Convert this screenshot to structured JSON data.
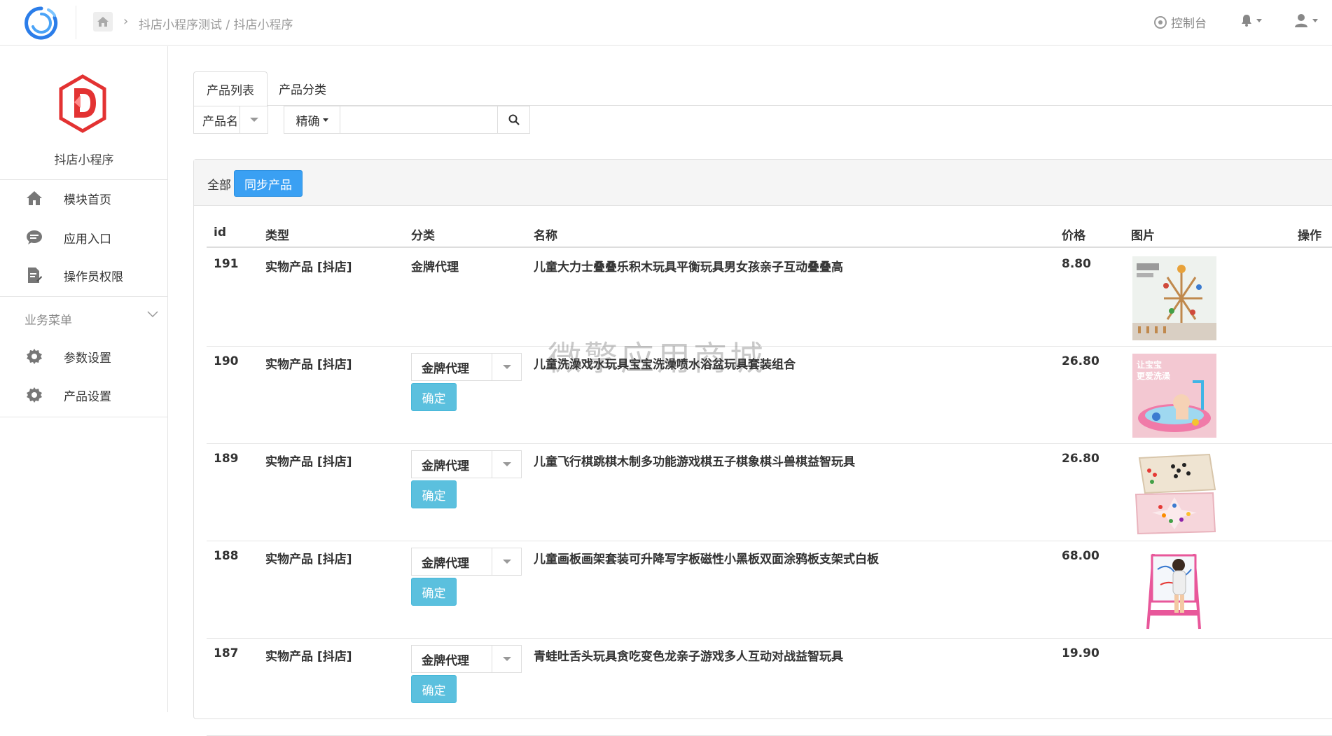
{
  "header": {
    "breadcrumb": "抖店小程序测试 / 抖店小程序",
    "console_label": "控制台"
  },
  "sidebar": {
    "app_name": "抖店小程序",
    "items": [
      {
        "label": "模块首页",
        "icon": "home-icon"
      },
      {
        "label": "应用入口",
        "icon": "chat-icon"
      },
      {
        "label": "操作员权限",
        "icon": "document-edit-icon"
      }
    ],
    "group_label": "业务菜单",
    "group_items": [
      {
        "label": "参数设置",
        "icon": "gear-icon"
      },
      {
        "label": "产品设置",
        "icon": "gear-icon"
      }
    ]
  },
  "tabs": [
    "产品列表",
    "产品分类"
  ],
  "search": {
    "field_label": "产品名",
    "mode_label": "精确",
    "keyword": ""
  },
  "filter": {
    "all_label": "全部",
    "sync_button": "同步产品"
  },
  "table": {
    "columns": [
      "id",
      "类型",
      "分类",
      "名称",
      "价格",
      "图片",
      "操作"
    ],
    "confirm_label": "确定",
    "rows": [
      {
        "id": "191",
        "type": "实物产品 [抖店]",
        "category": "金牌代理",
        "name": "儿童大力士叠叠乐积木玩具平衡玩具男女孩亲子互动叠叠高",
        "price": "8.80",
        "image": "blocks"
      },
      {
        "id": "190",
        "type": "实物产品 [抖店]",
        "category": "金牌代理",
        "name": "儿童洗澡戏水玩具宝宝洗澡喷水浴盆玩具套装组合",
        "price": "26.80",
        "image": "bath",
        "image_caption": "让宝宝\n更爱洗澡"
      },
      {
        "id": "189",
        "type": "实物产品 [抖店]",
        "category": "金牌代理",
        "name": "儿童飞行棋跳棋木制多功能游戏棋五子棋象棋斗兽棋益智玩具",
        "price": "26.80",
        "image": "board"
      },
      {
        "id": "188",
        "type": "实物产品 [抖店]",
        "category": "金牌代理",
        "name": "儿童画板画架套装可升降写字板磁性小黑板双面涂鸦板支架式白板",
        "price": "68.00",
        "image": "easel"
      },
      {
        "id": "187",
        "type": "实物产品 [抖店]",
        "category": "金牌代理",
        "name": "青蛙吐舌头玩具贪吃变色龙亲子游戏多人互动对战益智玩具",
        "price": "19.90",
        "image": "none"
      }
    ]
  },
  "watermark": "微擎应用商城",
  "colors": {
    "primary": "#3aa0f3",
    "info": "#5bc0de",
    "brand_red": "#e33232"
  }
}
